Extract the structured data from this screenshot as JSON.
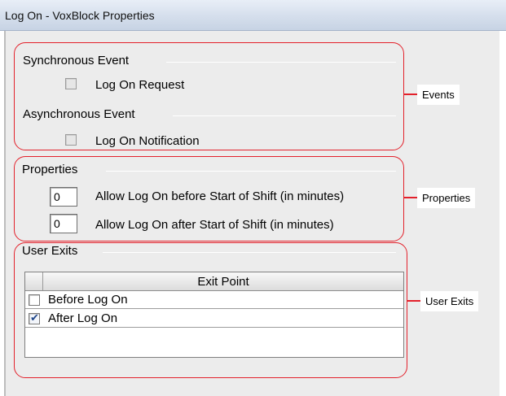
{
  "window": {
    "title": "Log On - VoxBlock Properties"
  },
  "events_group": {
    "synchronous_title": "Synchronous Event",
    "log_on_request": {
      "label": "Log On Request",
      "checked": false
    },
    "asynchronous_title": "Asynchronous Event",
    "log_on_notification": {
      "label": "Log On Notification",
      "checked": false
    }
  },
  "properties_group": {
    "title": "Properties",
    "before_shift": {
      "value": "0",
      "label": "Allow Log On before Start of Shift (in minutes)"
    },
    "after_shift": {
      "value": "0",
      "label": "Allow Log On after Start of Shift (in minutes)"
    }
  },
  "user_exits_group": {
    "title": "User Exits",
    "table": {
      "header": "Exit Point",
      "rows": [
        {
          "label": "Before Log On",
          "checked": false
        },
        {
          "label": "After Log On",
          "checked": true
        }
      ]
    }
  },
  "callouts": {
    "events": "Events",
    "properties": "Properties",
    "user_exits": "User Exits",
    "color": "#e3212b"
  }
}
